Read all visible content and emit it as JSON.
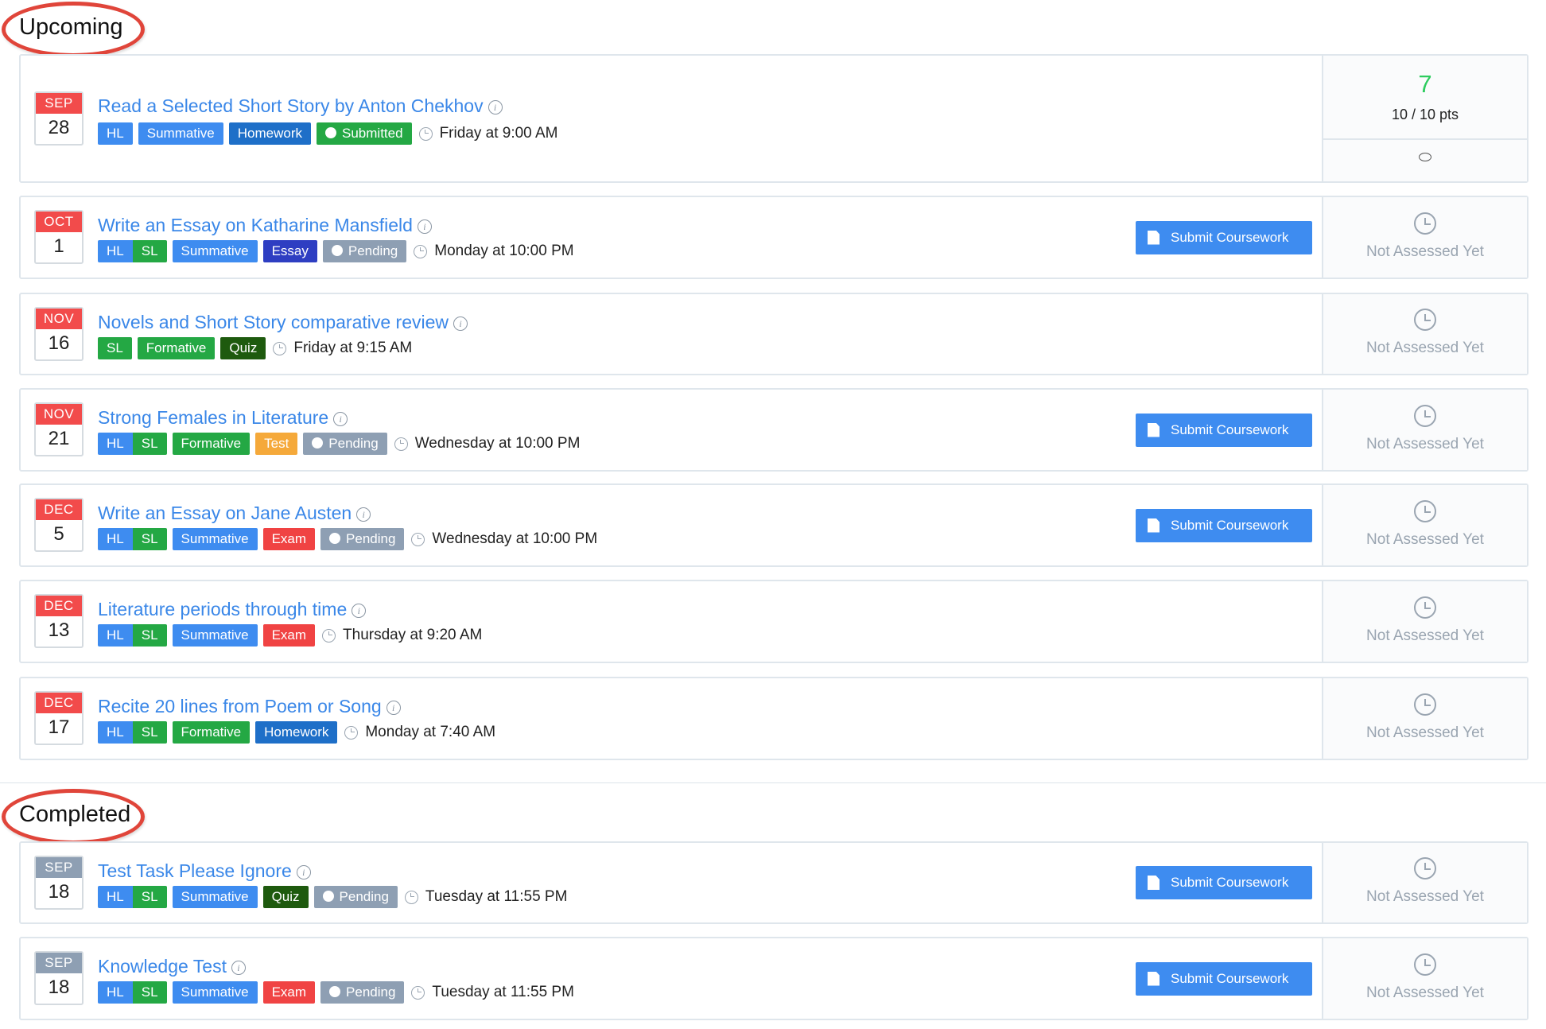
{
  "sections": {
    "upcoming": {
      "title": "Upcoming"
    },
    "completed": {
      "title": "Completed"
    }
  },
  "labels": {
    "submit_coursework": "Submit Coursework",
    "not_assessed": "Not Assessed Yet",
    "info_glyph": "i"
  },
  "colors": {
    "HL": "#3e8cf0",
    "SL": "#24a844",
    "Summative": "#3e8cf0",
    "Formative": "#24a844",
    "Homework": "#1e6fc8",
    "Essay": "#2e3ec2",
    "Quiz": "#1e5a0e",
    "Test": "#f5a93a",
    "Exam": "#f04343",
    "Submitted": "#24a844",
    "Pending": "#8e9fb3",
    "score": "#2ecc5f",
    "link": "#3a87e8"
  },
  "assignments": [
    {
      "month": "SEP",
      "day": "28",
      "title": "Read a Selected Short Story by Anton Chekhov",
      "tags": [
        "HL",
        "Summative",
        "Homework"
      ],
      "status": "Submitted",
      "due": "Friday at 9:00 AM",
      "submit": false,
      "score": "7",
      "points": "10 / 10 pts",
      "comment_icon": "comment-icon"
    },
    {
      "month": "OCT",
      "day": "1",
      "title": "Write an Essay on Katharine Mansfield",
      "tags": [
        "HL",
        "SL",
        "Summative",
        "Essay"
      ],
      "status": "Pending",
      "due": "Monday at 10:00 PM",
      "submit": true
    },
    {
      "month": "NOV",
      "day": "16",
      "title": "Novels and Short Story comparative review",
      "tags": [
        "SL",
        "Formative",
        "Quiz"
      ],
      "status": "",
      "due": "Friday at 9:15 AM",
      "submit": false
    },
    {
      "month": "NOV",
      "day": "21",
      "title": "Strong Females in Literature",
      "tags": [
        "HL",
        "SL",
        "Formative",
        "Test"
      ],
      "status": "Pending",
      "due": "Wednesday at 10:00 PM",
      "submit": true
    },
    {
      "month": "DEC",
      "day": "5",
      "title": "Write an Essay on Jane Austen",
      "tags": [
        "HL",
        "SL",
        "Summative",
        "Exam"
      ],
      "status": "Pending",
      "due": "Wednesday at 10:00 PM",
      "submit": true
    },
    {
      "month": "DEC",
      "day": "13",
      "title": "Literature periods through time",
      "tags": [
        "HL",
        "SL",
        "Summative",
        "Exam"
      ],
      "status": "",
      "due": "Thursday at 9:20 AM",
      "submit": false
    },
    {
      "month": "DEC",
      "day": "17",
      "title": "Recite 20 lines from Poem or Song",
      "tags": [
        "HL",
        "SL",
        "Formative",
        "Homework"
      ],
      "status": "",
      "due": "Monday at 7:40 AM",
      "submit": false
    },
    {
      "month": "SEP",
      "day": "18",
      "title": "Test Task Please Ignore",
      "tags": [
        "HL",
        "SL",
        "Summative",
        "Quiz"
      ],
      "status": "Pending",
      "due": "Tuesday at 11:55 PM",
      "submit": true
    },
    {
      "month": "SEP",
      "day": "18",
      "title": "Knowledge Test",
      "tags": [
        "HL",
        "SL",
        "Summative",
        "Exam"
      ],
      "status": "Pending",
      "due": "Tuesday at 11:55 PM",
      "submit": true
    }
  ]
}
